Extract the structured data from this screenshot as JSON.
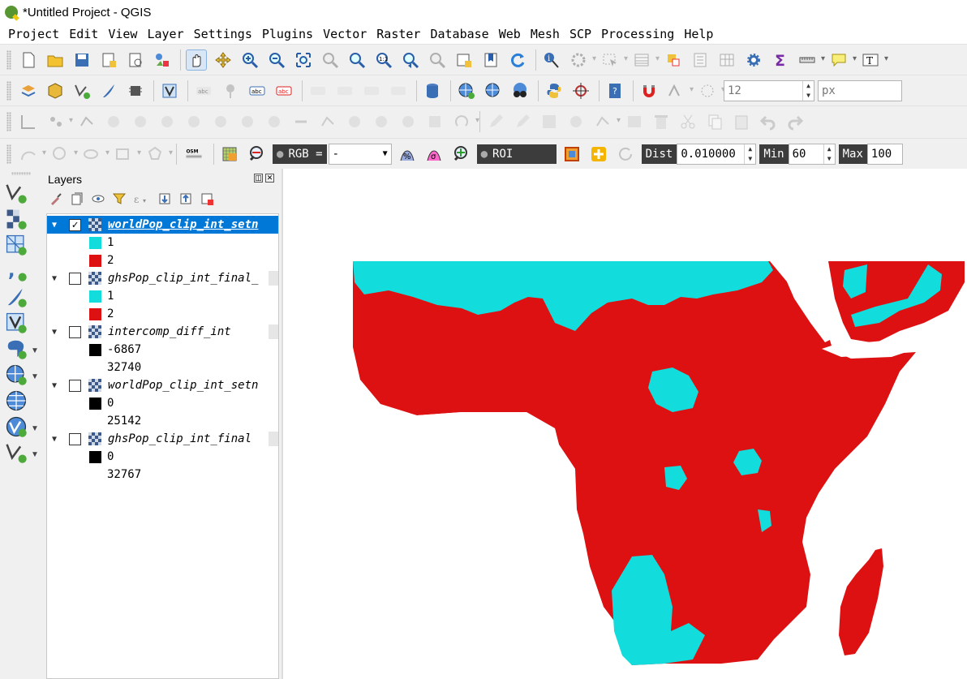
{
  "window": {
    "title": "*Untitled Project - QGIS"
  },
  "menu": [
    "Project",
    "Edit",
    "View",
    "Layer",
    "Settings",
    "Plugins",
    "Vector",
    "Raster",
    "Database",
    "Web",
    "Mesh",
    "SCP",
    "Processing",
    "Help"
  ],
  "toolbars": {
    "label_font_size": "12",
    "label_unit": "px",
    "scp": {
      "rgb_label": "RGB =",
      "rgb_value": "-",
      "roi_label": "ROI",
      "dist_label": "Dist",
      "dist_value": "0.010000",
      "min_label": "Min",
      "min_value": "60",
      "max_label": "Max",
      "max_value": "100"
    },
    "osm_label": "OSM"
  },
  "layers_panel": {
    "title": "Layers",
    "layers": [
      {
        "name": "worldPop_clip_int_setn",
        "checked": true,
        "selected": true,
        "legend": [
          {
            "label": "1",
            "color": "#13dcdc"
          },
          {
            "label": "2",
            "color": "#dd1111"
          }
        ]
      },
      {
        "name": "ghsPop_clip_int_final_",
        "checked": false,
        "selected": false,
        "legend": [
          {
            "label": "1",
            "color": "#13dcdc"
          },
          {
            "label": "2",
            "color": "#dd1111"
          }
        ]
      },
      {
        "name": "intercomp_diff_int",
        "checked": false,
        "selected": false,
        "legend": [
          {
            "label": "-6867",
            "color": "#000000"
          },
          {
            "label": "32740",
            "color": null
          }
        ]
      },
      {
        "name": "worldPop_clip_int_setn",
        "checked": false,
        "selected": false,
        "legend": [
          {
            "label": "0",
            "color": "#000000"
          },
          {
            "label": "25142",
            "color": null
          }
        ]
      },
      {
        "name": "ghsPop_clip_int_final",
        "checked": false,
        "selected": false,
        "legend": [
          {
            "label": "0",
            "color": "#000000"
          },
          {
            "label": "32767",
            "color": null
          }
        ]
      }
    ]
  },
  "map": {
    "class1_color": "#13dcdc",
    "class2_color": "#dd1111",
    "background": "#ffffff"
  }
}
